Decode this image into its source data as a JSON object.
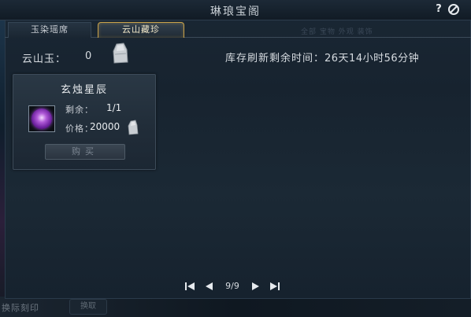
{
  "window": {
    "title": "琳琅宝阁"
  },
  "tabs": [
    {
      "label": "玉染瑶席",
      "active": false
    },
    {
      "label": "云山藏珍",
      "active": true
    }
  ],
  "background_text": {
    "bottom_left": "换际刻印",
    "bottom_button": "换取",
    "ghost_right": "全部 宝物 外观 装饰"
  },
  "currency": {
    "label": "云山玉：",
    "value": "0",
    "icon": "jade-token-icon"
  },
  "refresh": {
    "label": "库存刷新剩余时间：",
    "value": "26天14小时56分钟"
  },
  "items": [
    {
      "name": "玄烛星辰",
      "icon": "purple-orb-icon",
      "remaining_label": "剩余：",
      "remaining_value": "1/1",
      "price_label": "价格：",
      "price_value": "20000",
      "buy_label": "购买",
      "buy_enabled": false
    }
  ],
  "pagination": {
    "text": "9/9",
    "current": 9,
    "total": 9
  },
  "colors": {
    "accent_gold": "#c9a24a",
    "orb_purple": "#9b4ad0",
    "panel_bg": "#1a2734"
  }
}
